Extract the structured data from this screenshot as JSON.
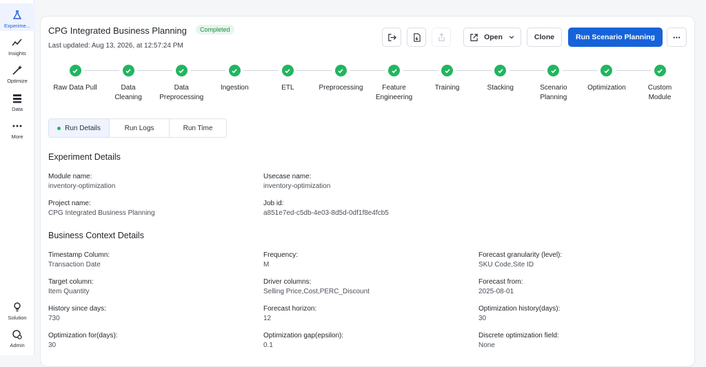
{
  "sidebar": {
    "items": [
      {
        "label": "Experime...",
        "icon": "flask-icon",
        "active": true
      },
      {
        "label": "Insights",
        "icon": "trend-icon",
        "active": false
      },
      {
        "label": "Optimize",
        "icon": "magic-wand-icon",
        "active": false
      },
      {
        "label": "Data",
        "icon": "database-icon",
        "active": false
      },
      {
        "label": "More",
        "icon": "more-icon",
        "active": false
      }
    ],
    "bottom_items": [
      {
        "label": "Solution",
        "icon": "lightbulb-icon"
      },
      {
        "label": "Admin",
        "icon": "admin-icon"
      }
    ]
  },
  "header": {
    "title": "CPG Integrated Business Planning",
    "status": "Completed",
    "last_updated": "Last updated: Aug 13, 2026, at 12:57:24 PM",
    "open_label": "Open",
    "clone_label": "Clone",
    "run_label": "Run Scenario Planning"
  },
  "pipeline": {
    "steps": [
      {
        "label": "Raw Data Pull"
      },
      {
        "label": "Data\nCleaning"
      },
      {
        "label": "Data\nPreprocessing"
      },
      {
        "label": "Ingestion"
      },
      {
        "label": "ETL"
      },
      {
        "label": "Preprocessing"
      },
      {
        "label": "Feature\nEngineering"
      },
      {
        "label": "Training"
      },
      {
        "label": "Stacking"
      },
      {
        "label": "Scenario\nPlanning"
      },
      {
        "label": "Optimization"
      },
      {
        "label": "Custom\nModule"
      }
    ]
  },
  "tabs": {
    "run_details": "Run Details",
    "run_logs": "Run Logs",
    "run_time": "Run Time"
  },
  "experiment": {
    "title": "Experiment Details",
    "module_label": "Module name:",
    "module_value": "inventory-optimization",
    "usecase_label": "Usecase name:",
    "usecase_value": "inventory-optimization",
    "project_label": "Project name:",
    "project_value": "CPG Integrated Business Planning",
    "job_label": "Job id:",
    "job_value": "a851e7ed-c5db-4e03-8d5d-0df1f8e4fcb5"
  },
  "business": {
    "title": "Business Context Details",
    "fields": [
      {
        "label": "Timestamp Column:",
        "value": "Transaction Date"
      },
      {
        "label": "Frequency:",
        "value": "M"
      },
      {
        "label": "Forecast granularity (level):",
        "value": "SKU Code,Site ID"
      },
      {
        "label": "Target column:",
        "value": "Item Quantity"
      },
      {
        "label": "Driver columns:",
        "value": "Selling Price,Cost,PERC_Discount"
      },
      {
        "label": "Forecast from:",
        "value": "2025-08-01"
      },
      {
        "label": "History since days:",
        "value": "730"
      },
      {
        "label": "Forecast horizon:",
        "value": "12"
      },
      {
        "label": "Optimization history(days):",
        "value": "30"
      },
      {
        "label": "Optimization for(days):",
        "value": "30"
      },
      {
        "label": "Optimization gap(epsilon):",
        "value": "0.1"
      },
      {
        "label": "Discrete optimization field:",
        "value": "None"
      }
    ]
  },
  "colors": {
    "accent": "#1663d9",
    "success": "#22b560"
  }
}
